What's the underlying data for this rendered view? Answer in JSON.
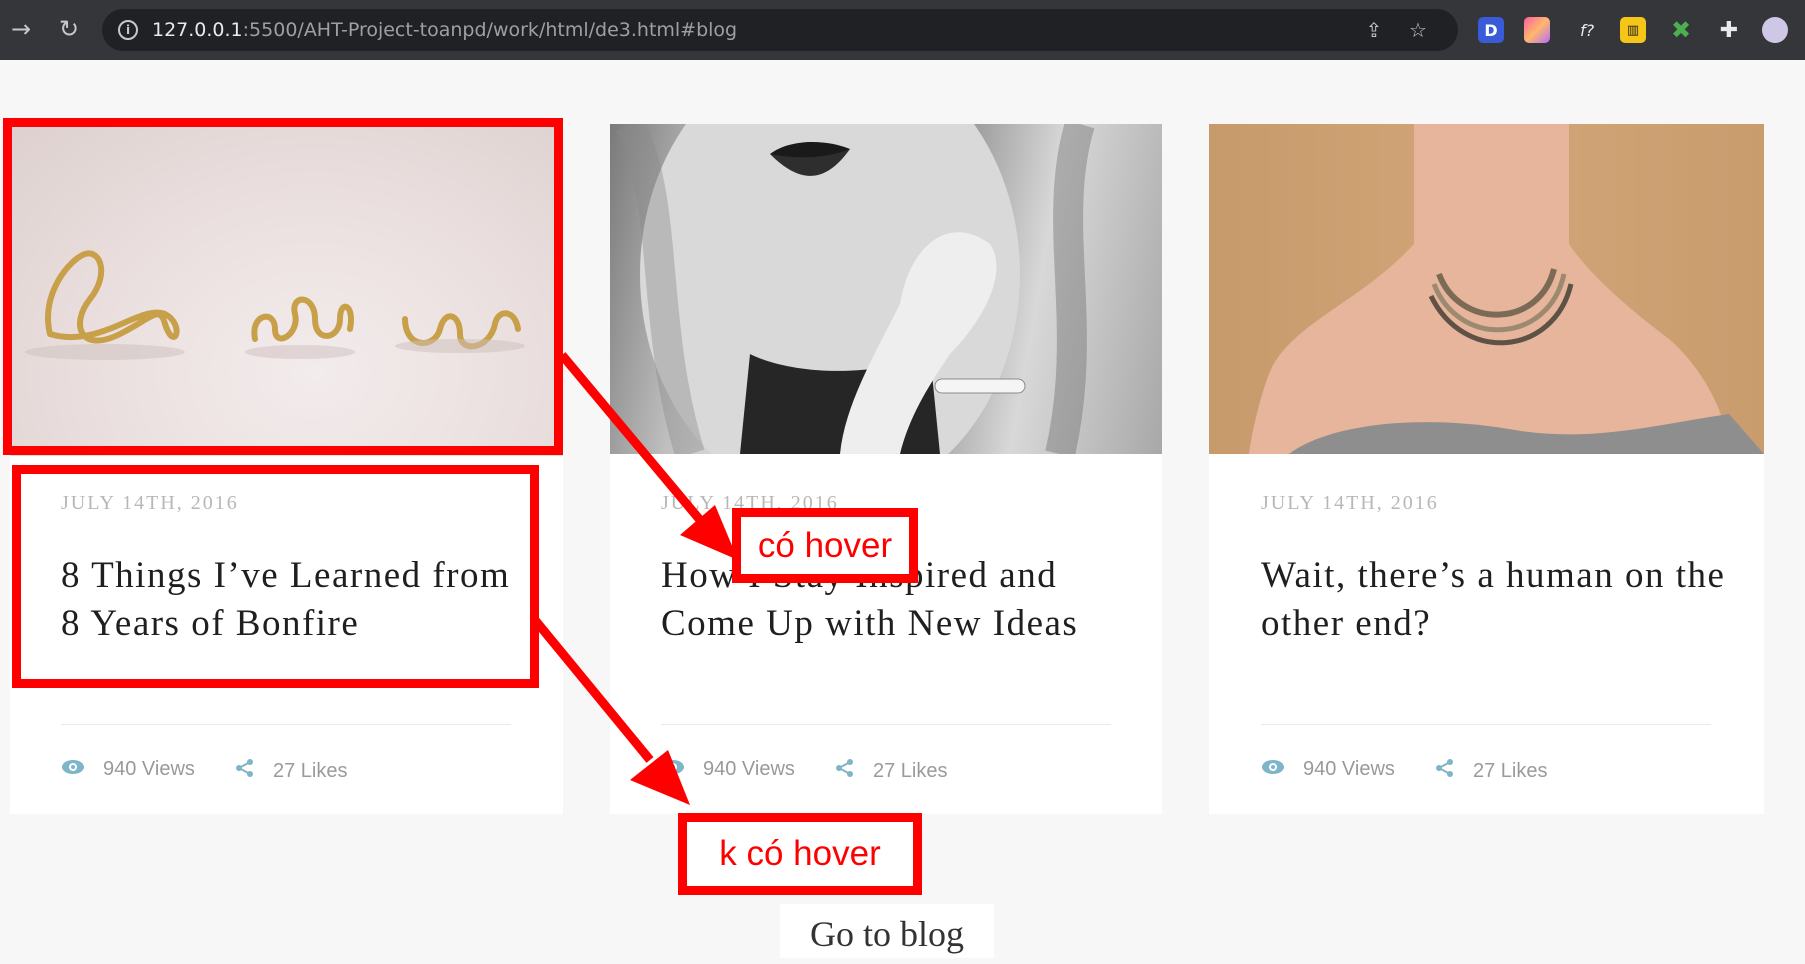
{
  "browser": {
    "url_host": "127.0.0.1",
    "url_rest": ":5500/AHT-Project-toanpd/work/html/de3.html#blog",
    "ext_d": "D",
    "ext_f": "f?"
  },
  "posts": [
    {
      "date": "JULY 14TH, 2016",
      "title": "8 Things I’ve Learned from 8 Years of Bonfire",
      "views": "940 Views",
      "likes": "27 Likes"
    },
    {
      "date": "JULY 14TH, 2016",
      "title": "How I Stay Inspired and Come Up with New Ideas",
      "views": "940 Views",
      "likes": "27 Likes"
    },
    {
      "date": "JULY 14TH, 2016",
      "title": "Wait, there’s a human on the other end?",
      "views": "940 Views",
      "likes": "27 Likes"
    }
  ],
  "goto_blog": "Go to blog",
  "annotations": {
    "hover": "có hover",
    "no_hover": "k có hover",
    "color": "#ff0000"
  },
  "colors": {
    "accent_icon": "#7fb5c9",
    "page_bg": "#f7f7f7",
    "chrome_bg": "#35363a"
  }
}
